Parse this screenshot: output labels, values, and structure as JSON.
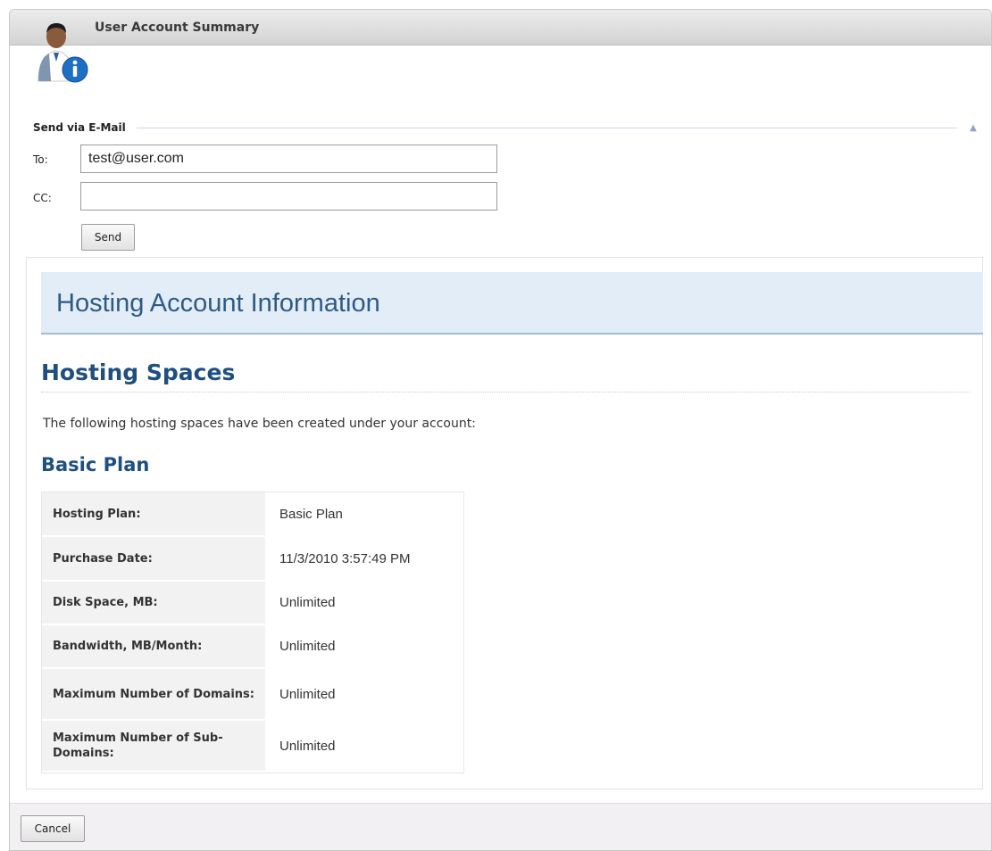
{
  "window": {
    "title": "User Account Summary",
    "icon": "user-info-icon"
  },
  "email_section": {
    "header": "Send via E-Mail",
    "collapse_icon": "collapse-up-icon",
    "to_label": "To:",
    "to_value": "test@user.com",
    "cc_label": "CC:",
    "cc_value": "",
    "send_label": "Send"
  },
  "content": {
    "banner_title": "Hosting Account Information",
    "section_title": "Hosting Spaces",
    "intro": "The following hosting spaces have been created under your account:",
    "plan_title": "Basic Plan",
    "plan_rows": [
      {
        "key": "Hosting Plan:",
        "value": "Basic Plan"
      },
      {
        "key": "Purchase Date:",
        "value": "11/3/2010 3:57:49 PM"
      },
      {
        "key": "Disk Space, MB:",
        "value": "Unlimited"
      },
      {
        "key": "Bandwidth, MB/Month:",
        "value": "Unlimited"
      },
      {
        "key": "Maximum Number of Domains:",
        "value": "Unlimited"
      },
      {
        "key": "Maximum Number of Sub-Domains:",
        "value": "Unlimited"
      }
    ]
  },
  "footer": {
    "cancel_label": "Cancel"
  },
  "colors": {
    "heading_blue": "#1f4f80",
    "banner_bg": "#e3edf8",
    "banner_border": "#9fbcd9",
    "info_icon_blue": "#1d6fc4"
  }
}
